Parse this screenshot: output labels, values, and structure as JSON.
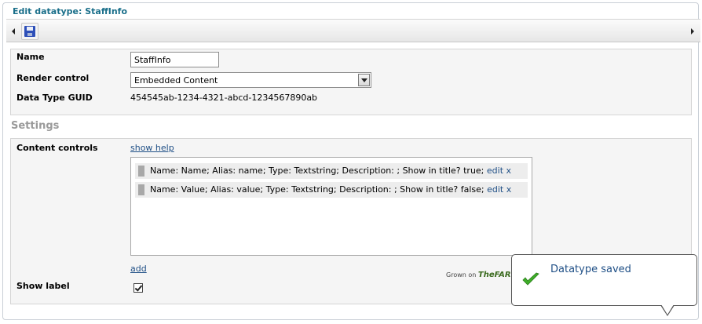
{
  "panel": {
    "title": "Edit datatype: StaffInfo"
  },
  "toolbar": {
    "save_icon": "floppy-disk-icon"
  },
  "fields": {
    "name_label": "Name",
    "name_value": "StaffInfo",
    "render_label": "Render control",
    "render_value": "Embedded Content",
    "guid_label": "Data Type GUID",
    "guid_value": "454545ab-1234-4321-abcd-1234567890ab"
  },
  "settings": {
    "heading": "Settings",
    "content_controls_label": "Content controls",
    "show_help": "show help",
    "items": [
      {
        "text": "Name: Name; Alias: name; Type: Textstring; Description: ; Show in title? true;",
        "edit": "edit",
        "remove": "x"
      },
      {
        "text": "Name: Value; Alias: value; Type: Textstring; Description: ; Show in title? false;",
        "edit": "edit",
        "remove": "x"
      }
    ],
    "add": "add",
    "show_label": "Show label",
    "show_label_checked": true
  },
  "footer": {
    "grown_on": "Grown on",
    "brand": "TheFARM"
  },
  "notification": {
    "message": "Datatype saved",
    "icon": "checkmark-icon",
    "color": "#3fae29"
  }
}
